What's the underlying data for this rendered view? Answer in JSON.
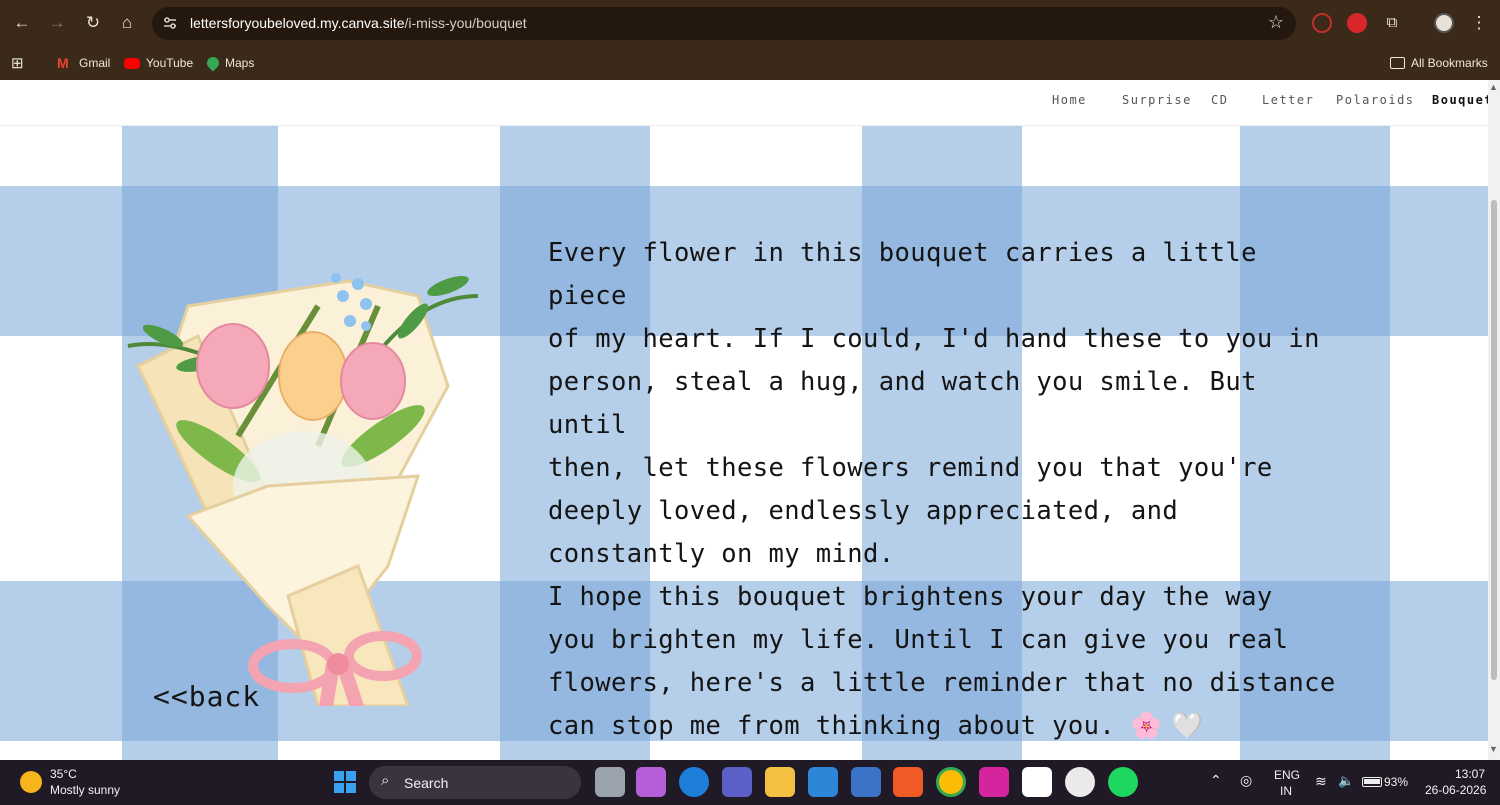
{
  "browser": {
    "url_host": "lettersforyoubeloved.my.canva.site",
    "url_path": "/i-miss-you/bouquet",
    "bookmarks": [
      "Gmail",
      "YouTube",
      "Maps"
    ],
    "all_bookmarks": "All Bookmarks"
  },
  "site": {
    "nav": [
      "Home",
      "Surprise",
      "CD",
      "Letter",
      "Polaroids",
      "Bouquet"
    ],
    "active_nav": "Bouquet",
    "message_lines": [
      "Every flower in this bouquet carries a little piece",
      "of my heart. If I could, I'd hand these to you in",
      "person, steal a hug, and watch you smile. But until",
      "then, let these flowers remind you that you're",
      "deeply loved, endlessly appreciated, and",
      "constantly on my mind.",
      "I hope this bouquet brightens your day the way",
      "you brighten my life. Until I can give you real",
      "flowers, here's a little reminder that no distance",
      "can stop me from thinking about you."
    ],
    "emoji": "🌸 🤍",
    "back_label": "<<back"
  },
  "taskbar": {
    "temp": "35°C",
    "weather": "Mostly sunny",
    "search_label": "Search",
    "lang_top": "ENG",
    "lang_bottom": "IN",
    "battery": "93%",
    "time": "13:07",
    "date": "26-06-2026"
  }
}
